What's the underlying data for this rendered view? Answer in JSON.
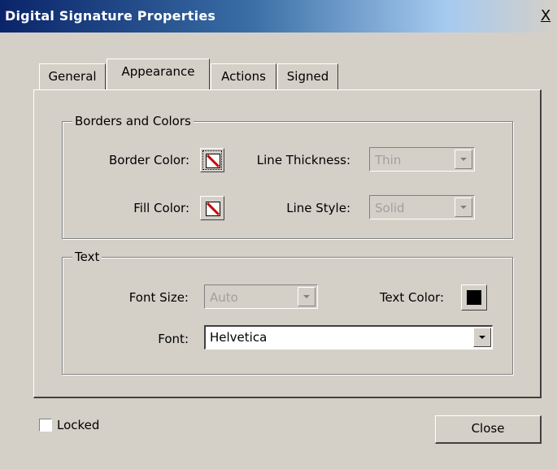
{
  "window": {
    "title": "Digital Signature Properties",
    "close_glyph": "X"
  },
  "tabs": [
    {
      "label": "General",
      "active": false
    },
    {
      "label": "Appearance",
      "active": true
    },
    {
      "label": "Actions",
      "active": false
    },
    {
      "label": "Signed",
      "active": false
    }
  ],
  "borders_group": {
    "title": "Borders and Colors",
    "border_color_label": "Border Color:",
    "fill_color_label": "Fill Color:",
    "line_thickness_label": "Line Thickness:",
    "line_thickness_value": "Thin",
    "line_style_label": "Line Style:",
    "line_style_value": "Solid",
    "border_swatch_icon": "no-color-icon",
    "fill_swatch_icon": "no-color-icon"
  },
  "text_group": {
    "title": "Text",
    "font_size_label": "Font Size:",
    "font_size_value": "Auto",
    "text_color_label": "Text Color:",
    "text_color": "#000000",
    "font_label": "Font:",
    "font_value": "Helvetica"
  },
  "footer": {
    "locked_label": "Locked",
    "locked_checked": false,
    "close_label": "Close"
  },
  "colors": {
    "face": "#d4d0c8",
    "no_color_slash": "#cc0000"
  }
}
